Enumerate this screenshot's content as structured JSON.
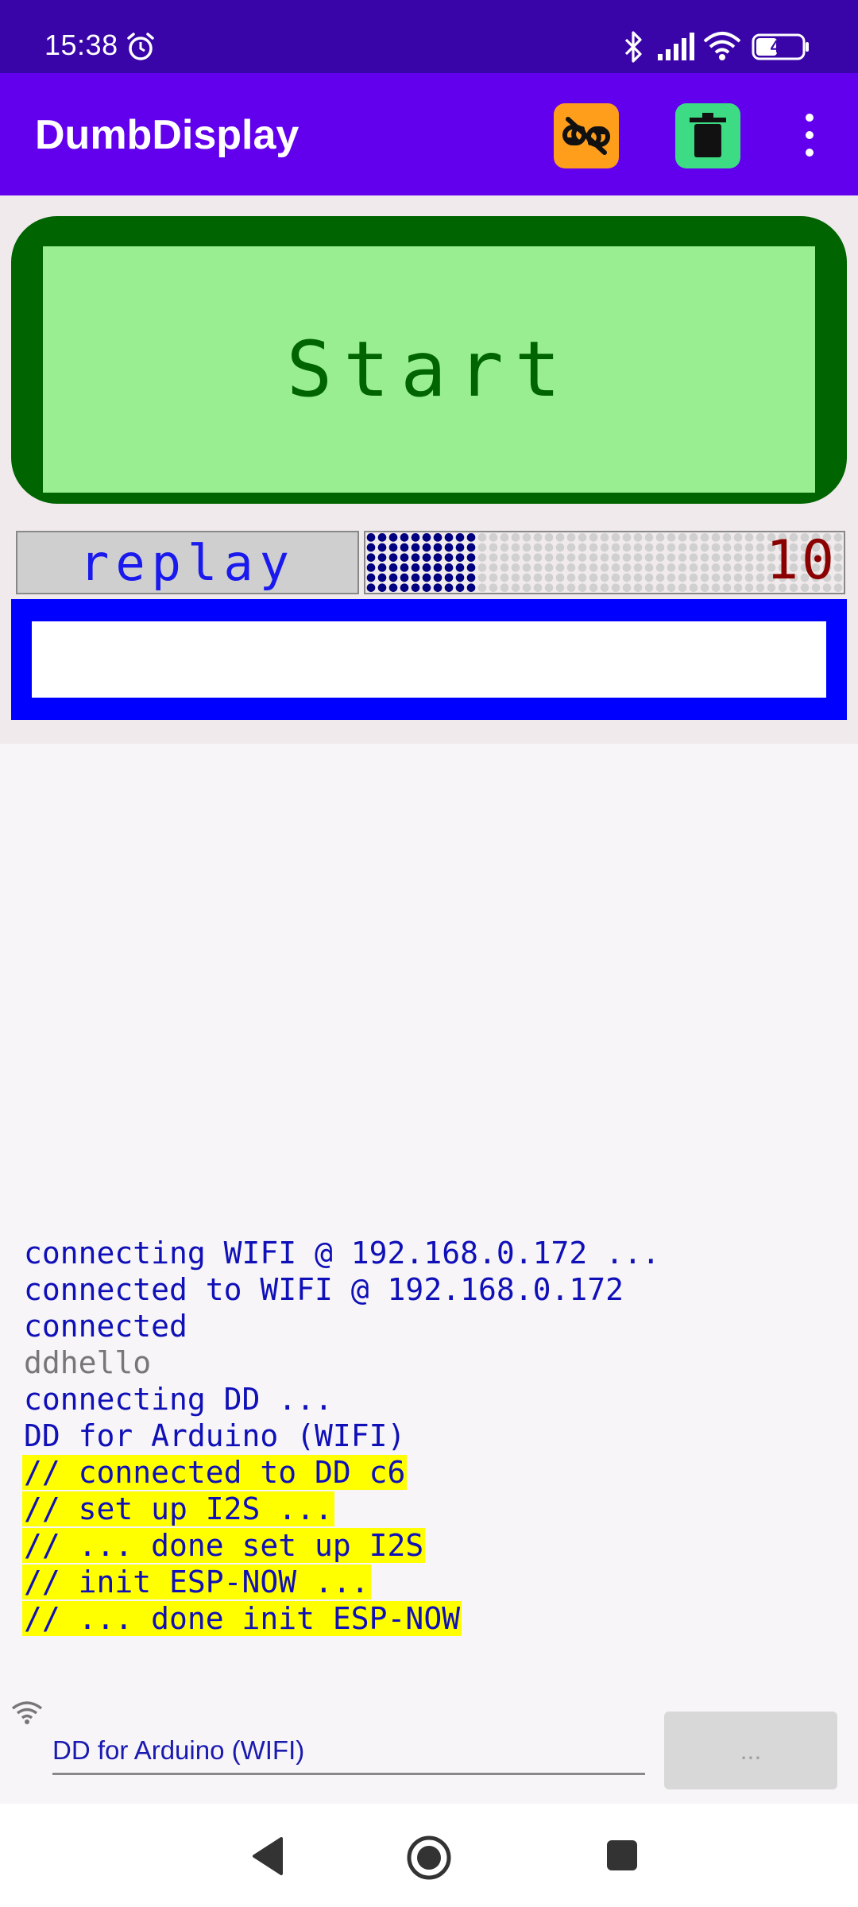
{
  "status_bar": {
    "time": "15:38",
    "battery": "41",
    "icons": [
      "alarm-icon",
      "bluetooth-icon",
      "signal-icon",
      "wifi-icon",
      "battery-icon"
    ]
  },
  "app_bar": {
    "title": "DumbDisplay",
    "actions": [
      "unlink-icon",
      "trash-icon",
      "more-vert-icon"
    ],
    "colors": {
      "bar": "#6200ee",
      "unlink_bg": "#ff9e1b",
      "trash_bg": "#3ddc84"
    }
  },
  "display": {
    "start_label": "Start",
    "replay_label": "replay",
    "progress": {
      "value": 10,
      "label": "10",
      "fraction": 0.25
    },
    "text_panel_value": "",
    "colors": {
      "start_border": "#006400",
      "start_fill": "#98ee90",
      "progress_on": "#000080",
      "progress_number": "#8b0000",
      "text_border": "#0000ff"
    }
  },
  "log": [
    {
      "text": "connecting WIFI @ 192.168.0.172 ...",
      "style": "blue"
    },
    {
      "text": "connected to WIFI @ 192.168.0.172",
      "style": "blue"
    },
    {
      "text": "connected",
      "style": "blue"
    },
    {
      "text": "ddhello",
      "style": "gray"
    },
    {
      "text": "connecting DD ...",
      "style": "blue"
    },
    {
      "text": "DD for Arduino (WIFI)",
      "style": "blue"
    },
    {
      "text": "// connected to DD c6",
      "style": "highlight"
    },
    {
      "text": "// set up I2S ...",
      "style": "highlight"
    },
    {
      "text": "// ... done set up I2S",
      "style": "highlight"
    },
    {
      "text": "// init ESP-NOW ...",
      "style": "highlight"
    },
    {
      "text": "// ... done init ESP-NOW",
      "style": "highlight"
    }
  ],
  "connection": {
    "status_text": "DD for Arduino (WIFI)",
    "button_label": "...",
    "icon": "wifi-icon"
  },
  "nav": {
    "icons": [
      "back-icon",
      "home-icon",
      "recents-icon"
    ]
  }
}
